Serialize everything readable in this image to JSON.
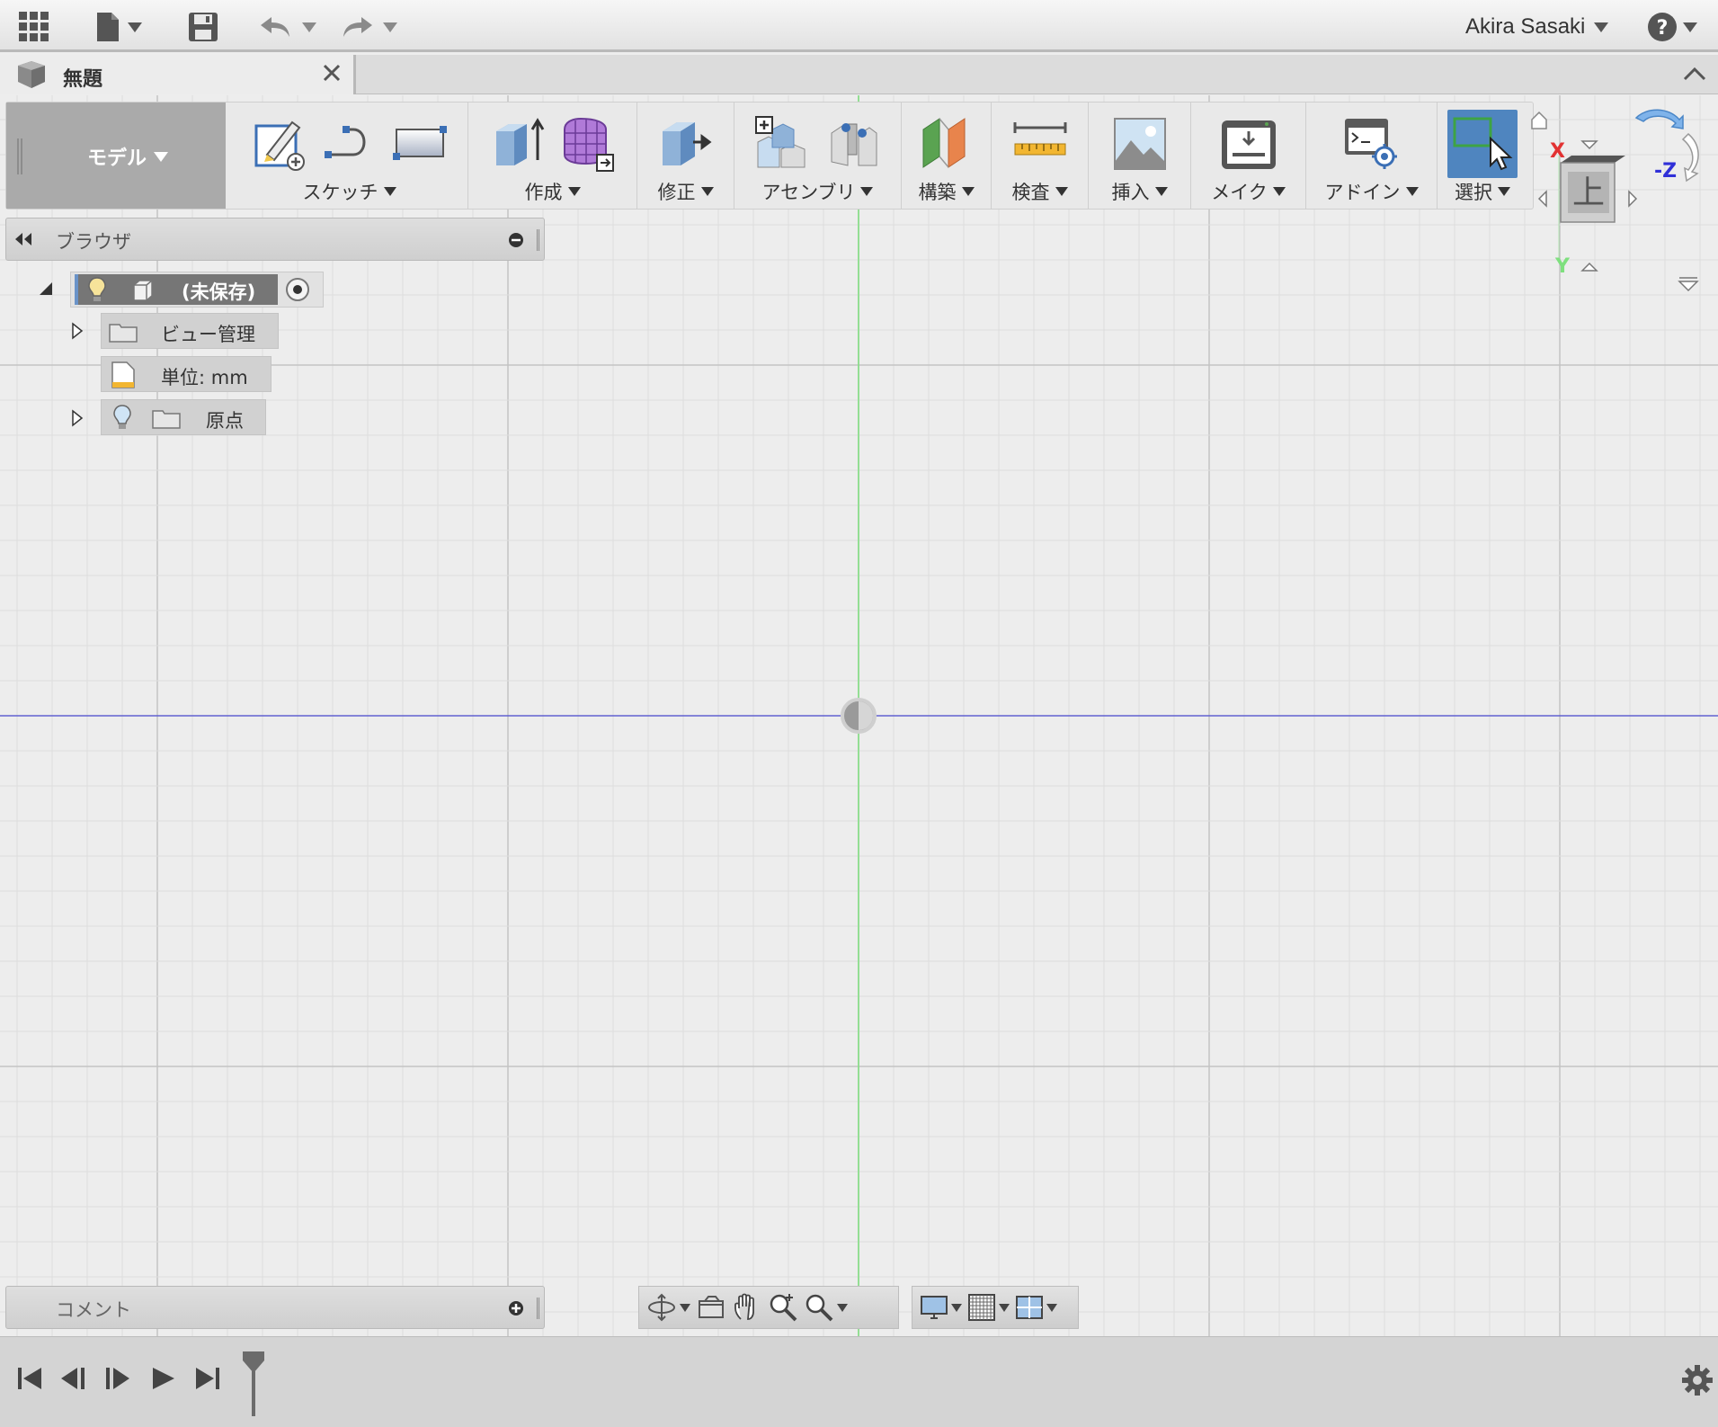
{
  "appbar": {
    "user_name": "Akira Sasaki",
    "icons": [
      "apps-grid-icon",
      "file-icon",
      "save-icon",
      "undo-icon",
      "redo-icon",
      "help-icon"
    ]
  },
  "document": {
    "tab_title": "無題"
  },
  "toolbar": {
    "workspace_label": "モデル",
    "groups": [
      {
        "label": "スケッチ",
        "icons": [
          "create-sketch-icon",
          "sketch-line-icon",
          "rectangle-icon"
        ]
      },
      {
        "label": "作成",
        "icons": [
          "extrude-icon",
          "form-icon"
        ]
      },
      {
        "label": "修正",
        "icons": [
          "press-pull-icon"
        ]
      },
      {
        "label": "アセンブリ",
        "icons": [
          "new-component-icon",
          "joint-icon"
        ]
      },
      {
        "label": "構築",
        "icons": [
          "offset-plane-icon"
        ]
      },
      {
        "label": "検査",
        "icons": [
          "measure-icon"
        ]
      },
      {
        "label": "挿入",
        "icons": [
          "insert-image-icon"
        ]
      },
      {
        "label": "メイク",
        "icons": [
          "3d-print-icon"
        ]
      },
      {
        "label": "アドイン",
        "icons": [
          "scripts-addins-icon"
        ]
      },
      {
        "label": "選択",
        "icons": [
          "select-icon"
        ]
      }
    ]
  },
  "browser": {
    "title": "ブラウザ",
    "root_label": "(未保存)",
    "items": [
      {
        "label": "ビュー管理",
        "has_arrow": true,
        "has_bulb": false,
        "icon": "folder-icon"
      },
      {
        "label": "単位: mm",
        "has_arrow": false,
        "has_bulb": false,
        "icon": "units-document-icon"
      },
      {
        "label": "原点",
        "has_arrow": true,
        "has_bulb": true,
        "icon": "folder-icon"
      }
    ]
  },
  "comment": {
    "title": "コメント"
  },
  "viewcube": {
    "face_label": "上",
    "axis_x": "X",
    "axis_y": "Y",
    "axis_z": "-Z"
  },
  "colors": {
    "selection_blue": "#4f85bf",
    "x_axis_red": "#e23232",
    "y_axis_green": "#7ee07e",
    "z_axis_blue": "#3030d8",
    "accent_highlight": "#6a93c8"
  }
}
